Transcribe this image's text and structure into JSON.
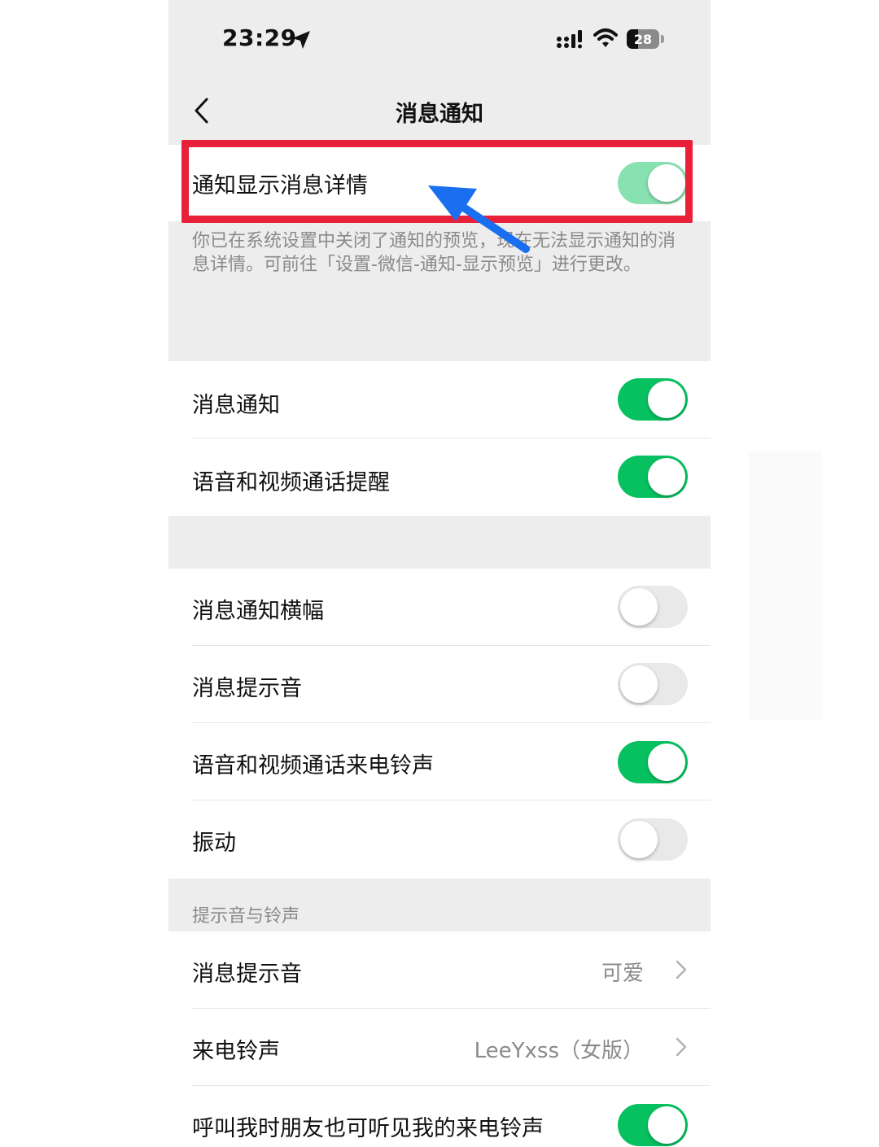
{
  "status_bar": {
    "time": "23:29",
    "battery": "28"
  },
  "nav": {
    "title": "消息通知"
  },
  "detail_row": {
    "label": "通知显示消息详情",
    "on": true,
    "disabled": true
  },
  "detail_footnote": "你已在系统设置中关闭了通知的预览，现在无法显示通知的消息详情。可前往「设置-微信-通知-显示预览」进行更改。",
  "group1": [
    {
      "label": "消息通知",
      "on": true
    },
    {
      "label": "语音和视频通话提醒",
      "on": true
    }
  ],
  "group2": [
    {
      "label": "消息通知横幅",
      "on": false
    },
    {
      "label": "消息提示音",
      "on": false
    },
    {
      "label": "语音和视频通话来电铃声",
      "on": true
    },
    {
      "label": "振动",
      "on": false
    }
  ],
  "sound_section": {
    "header": "提示音与铃声",
    "items": [
      {
        "label": "消息提示音",
        "value": "可爱"
      },
      {
        "label": "来电铃声",
        "value": "LeeYxss（女版）"
      }
    ],
    "friends_ringtone": {
      "label": "呼叫我时朋友也可听见我的来电铃声",
      "on": true
    }
  },
  "colors": {
    "toggle_on": "#07c160",
    "toggle_off": "#e9e9ea",
    "highlight": "#e8203a",
    "arrow": "#1a6ff0"
  }
}
